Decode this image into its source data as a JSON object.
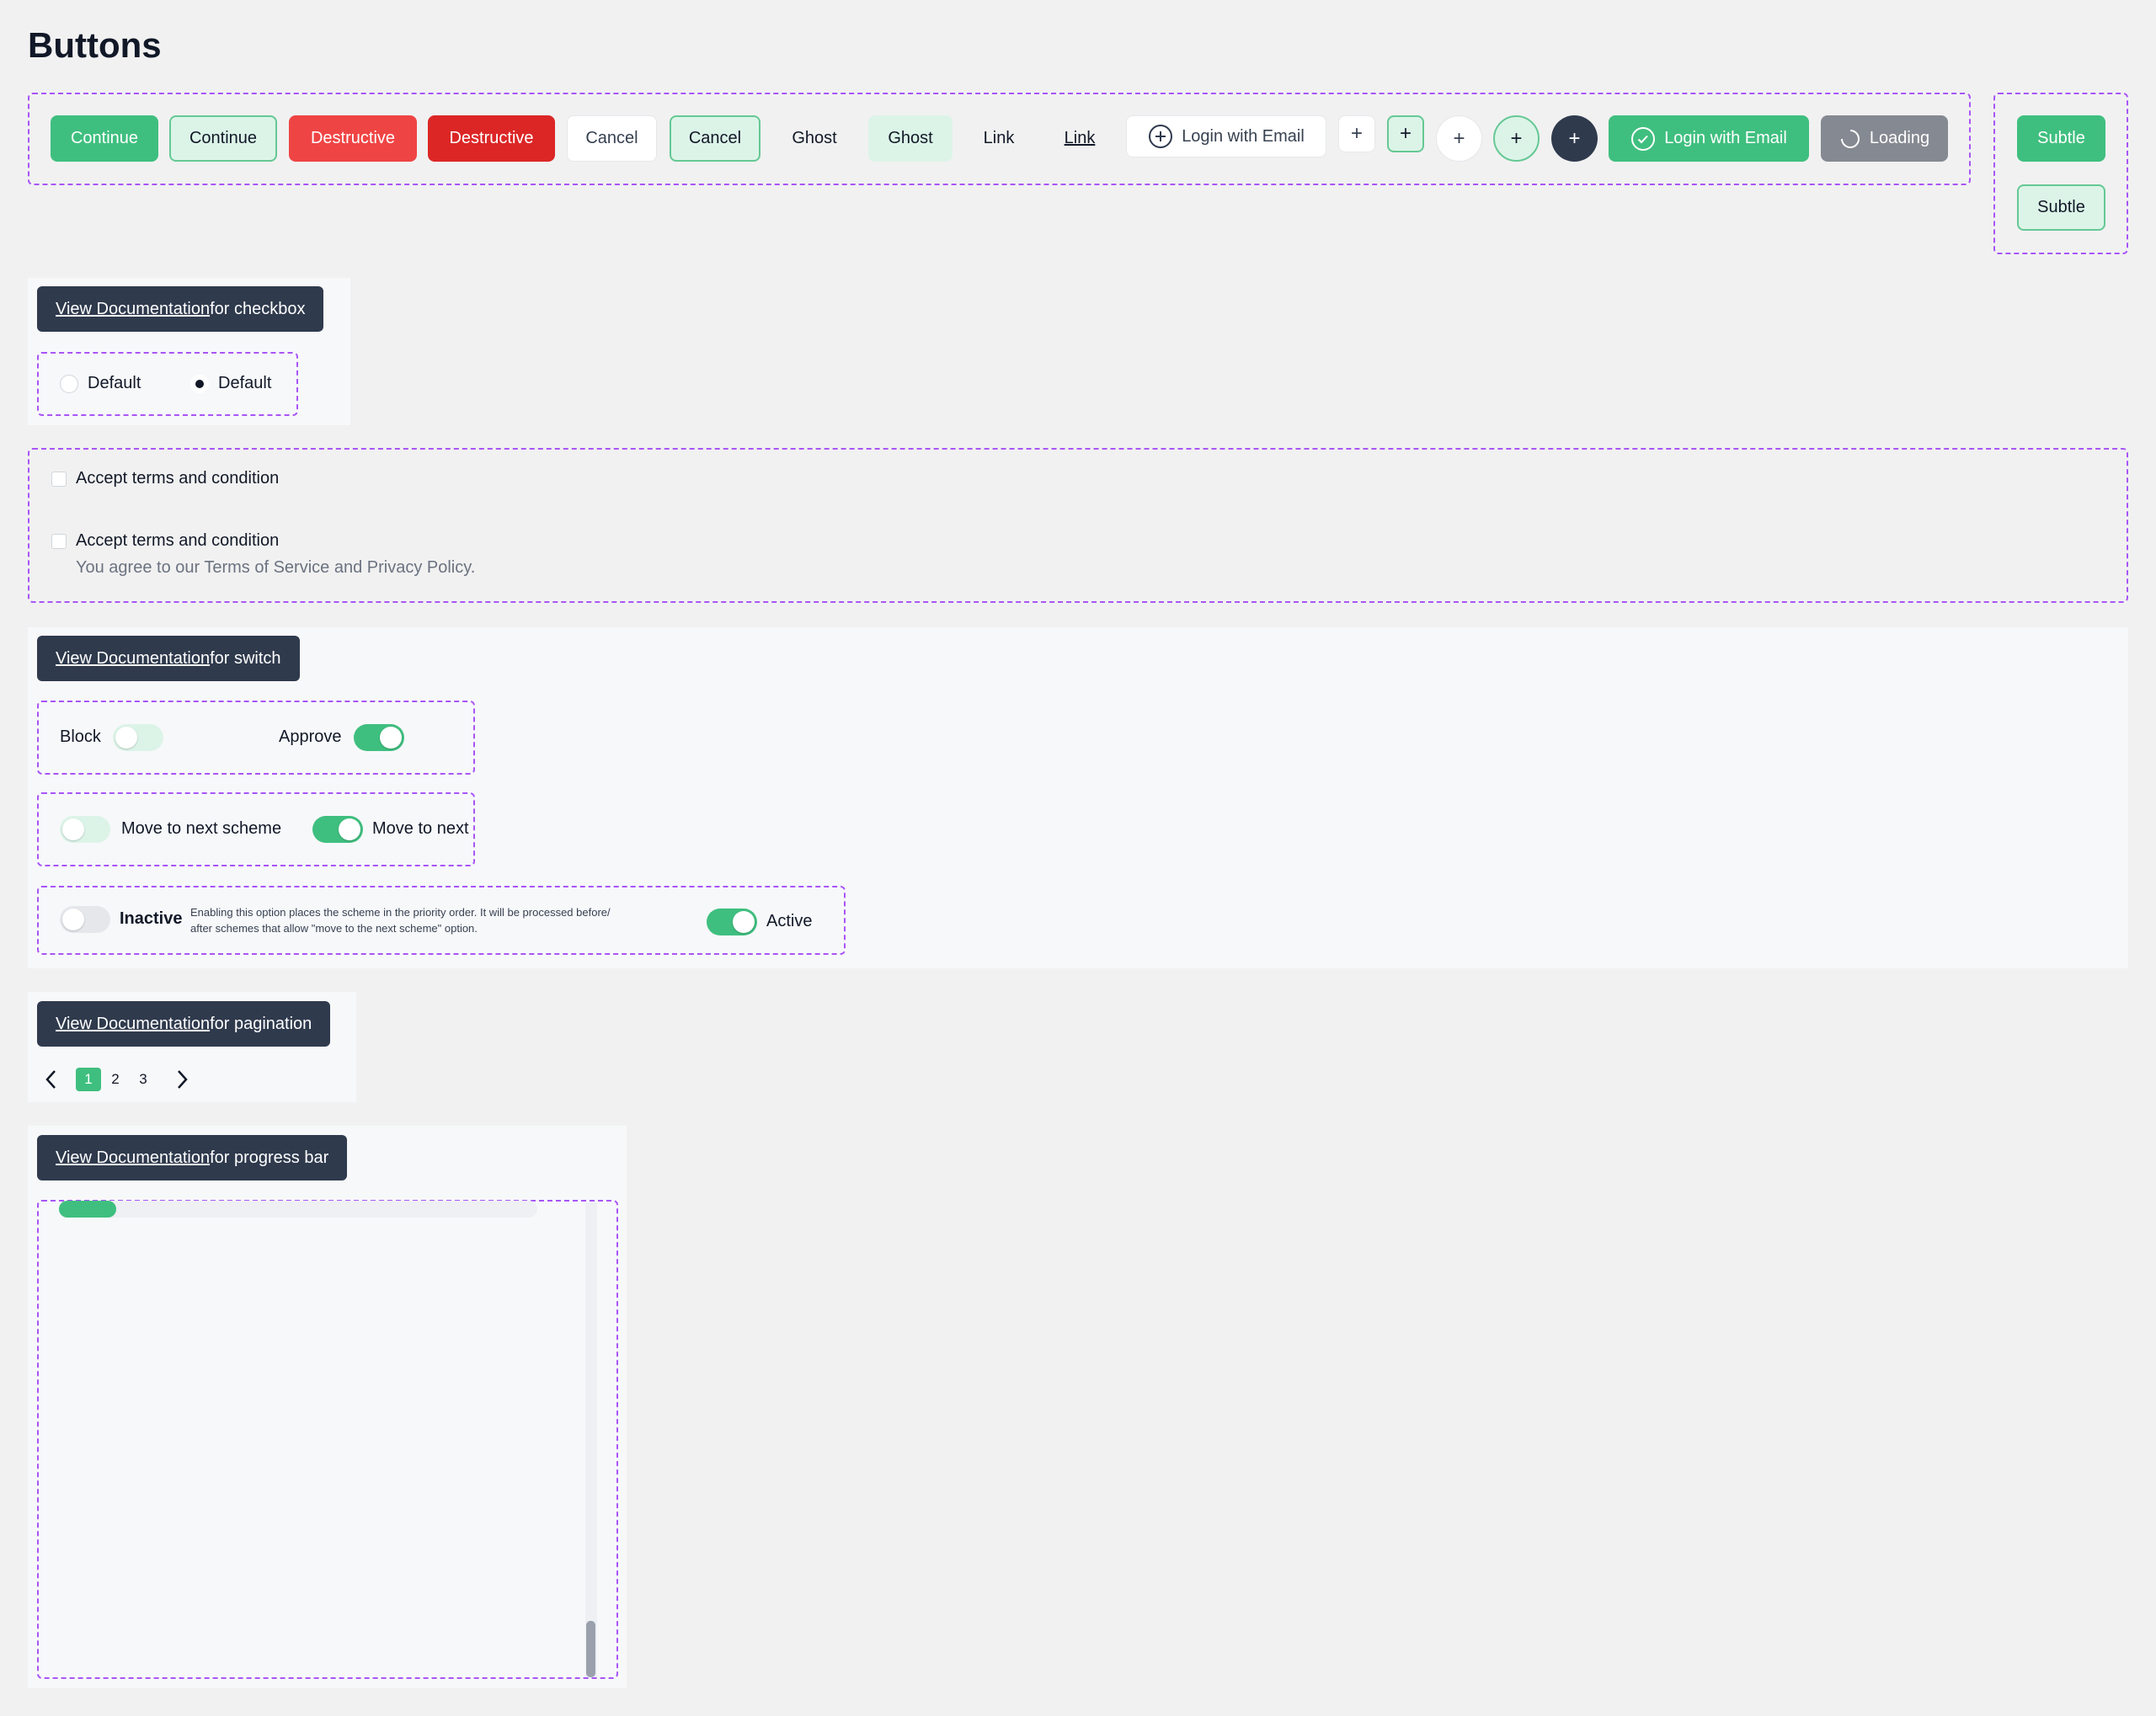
{
  "page": {
    "title": "Buttons"
  },
  "buttons": {
    "continue_1": "Continue",
    "continue_2": "Continue",
    "destructive_1": "Destructive",
    "destructive_2": "Destructive",
    "cancel_1": "Cancel",
    "cancel_2": "Cancel",
    "ghost_1": "Ghost",
    "ghost_2": "Ghost",
    "link_1": "Link",
    "link_2": "Link",
    "login_outline": "Login with Email",
    "plus": "+",
    "login_green": "Login with Email",
    "loading": "Loading",
    "subtle_1": "Subtle",
    "subtle_2": "Subtle"
  },
  "checkbox_section": {
    "doc_link": "View Documentation",
    "doc_suffix": " for checkbox",
    "radio_1": "Default",
    "radio_2": "Default",
    "terms_1": "Accept terms and condition",
    "terms_2": "Accept terms and condition",
    "terms_2_desc": "You agree to our Terms of Service and Privacy Policy."
  },
  "switch_section": {
    "doc_link": "View Documentation",
    "doc_suffix": " for switch",
    "block": "Block",
    "approve": "Approve",
    "move_1": "Move to next scheme",
    "move_2": "Move to next",
    "inactive": "Inactive",
    "description_line1": "Enabling this option places the scheme in the priority order. It will be processed before/",
    "description_line2": "after schemes that allow \"move to the next scheme\" option.",
    "active": "Active"
  },
  "pagination_section": {
    "doc_link": "View Documentation",
    "doc_suffix": " for pagination",
    "pages": [
      "1",
      "2",
      "3"
    ],
    "current": "1"
  },
  "progress_section": {
    "doc_link": "View Documentation",
    "doc_suffix": " for progress bar",
    "progress": 0.12
  },
  "colors": {
    "primary": "#3fbf7f",
    "destructive": "#ef4444",
    "dark": "#2f3a4d",
    "dashed_border": "#a855f7"
  }
}
